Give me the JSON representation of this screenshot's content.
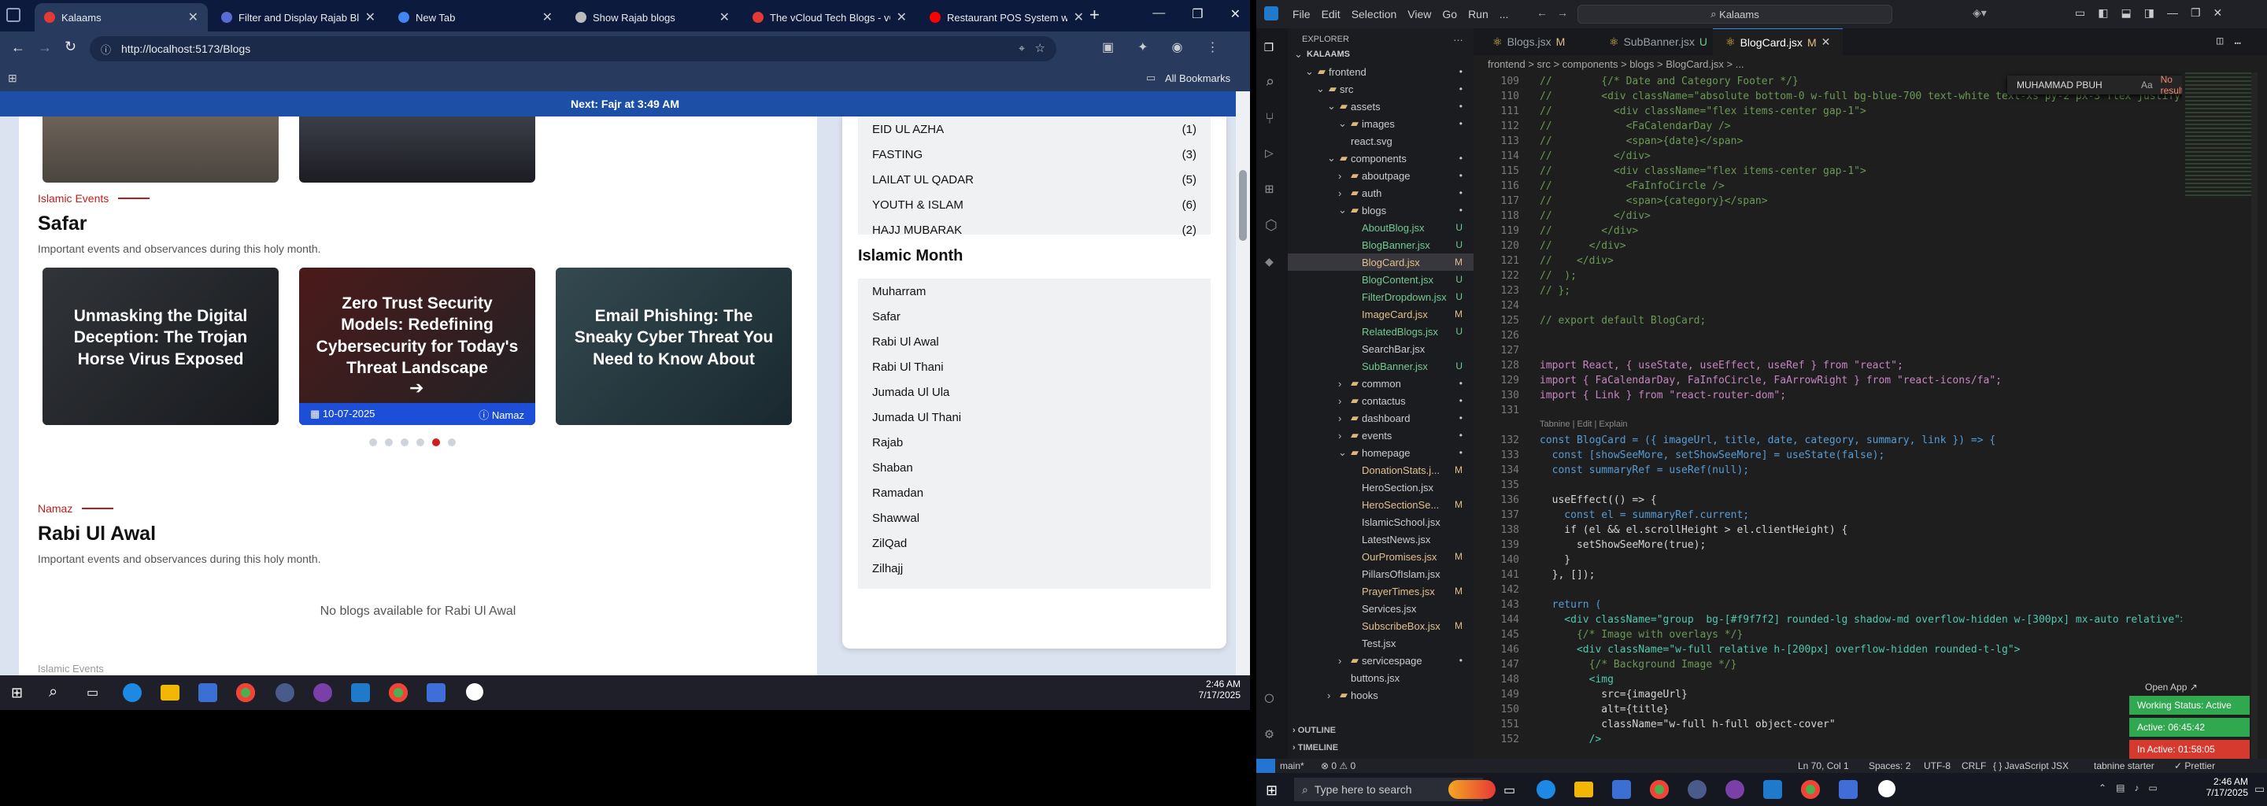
{
  "browser": {
    "tabs": [
      {
        "title": "Kalaams",
        "favicon_color": "#e53935",
        "active": true
      },
      {
        "title": "Filter and Display Rajab Blog",
        "favicon_color": "#5b6bd6",
        "active": false
      },
      {
        "title": "New Tab",
        "favicon_color": "#4285f4",
        "active": false
      },
      {
        "title": "Show Rajab blogs",
        "favicon_color": "#bbbbbb",
        "active": false
      },
      {
        "title": "The vCloud Tech Blogs - vCl",
        "favicon_color": "#e53935",
        "active": false
      },
      {
        "title": "Restaurant POS System with",
        "favicon_color": "#ff0000",
        "active": false
      }
    ],
    "url": "http://localhost:5173/Blogs",
    "bookmarks_label": "All Bookmarks"
  },
  "site": {
    "banner": "Next: Fajr at 3:49 AM",
    "sections": [
      {
        "tag": "Islamic Events",
        "title": "Safar",
        "description": "Important events and observances during this holy month.",
        "cards": [
          {
            "title": "Unmasking the Digital Deception: The Trojan Horse Virus Exposed",
            "color": "#3a3f46"
          },
          {
            "title": "Zero Trust Security Models: Redefining Cybersecurity for Today's Threat Landscape",
            "date": "10-07-2025",
            "category": "Namaz",
            "color": "#7a2b2b"
          },
          {
            "title": "Email Phishing: The Sneaky Cyber Threat You Need to Know About",
            "color": "#4d6e7a"
          }
        ],
        "slide_count": 6,
        "active_slide": 5
      },
      {
        "tag": "Namaz",
        "title": "Rabi Ul Awal",
        "description": "Important events and observances during this holy month.",
        "empty_text": "No blogs available for Rabi Ul Awal"
      }
    ],
    "next_section_stub": "Islamic Events",
    "categories": [
      {
        "name": "EID UL AZHA",
        "count": "(1)"
      },
      {
        "name": "FASTING",
        "count": "(3)"
      },
      {
        "name": "LAILAT UL QADAR",
        "count": "(5)"
      },
      {
        "name": "YOUTH & ISLAM",
        "count": "(6)"
      },
      {
        "name": "HAJJ MUBARAK",
        "count": "(2)"
      }
    ],
    "months_title": "Islamic Month",
    "months": [
      "Muharram",
      "Safar",
      "Rabi Ul Awal",
      "Rabi Ul Thani",
      "Jumada Ul Ula",
      "Jumada Ul Thani",
      "Rajab",
      "Shaban",
      "Ramadan",
      "Shawwal",
      "ZilQad",
      "Zilhajj"
    ]
  },
  "taskbar1": {
    "time": "2:46 AM",
    "date": "7/17/2025"
  },
  "vscode": {
    "menus": [
      "File",
      "Edit",
      "Selection",
      "View",
      "Go",
      "Run",
      "..."
    ],
    "search_text": "Kalaams",
    "explorer_title": "EXPLORER",
    "tree": [
      {
        "name": "KALAAMS",
        "depth": 0,
        "kind": "root"
      },
      {
        "name": "frontend",
        "depth": 1,
        "kind": "folder-open",
        "status": "•"
      },
      {
        "name": "src",
        "depth": 2,
        "kind": "folder-open",
        "status": "•"
      },
      {
        "name": "assets",
        "depth": 3,
        "kind": "folder-open",
        "status": "•"
      },
      {
        "name": "images",
        "depth": 4,
        "kind": "folder-open",
        "status": "•"
      },
      {
        "name": "react.svg",
        "depth": 4,
        "kind": "file"
      },
      {
        "name": "components",
        "depth": 3,
        "kind": "folder-open",
        "status": "•"
      },
      {
        "name": "aboutpage",
        "depth": 4,
        "kind": "folder",
        "status": "•"
      },
      {
        "name": "auth",
        "depth": 4,
        "kind": "folder",
        "status": "•"
      },
      {
        "name": "blogs",
        "depth": 4,
        "kind": "folder-open",
        "status": "•"
      },
      {
        "name": "AboutBlog.jsx",
        "depth": 5,
        "kind": "file",
        "status": "U"
      },
      {
        "name": "BlogBanner.jsx",
        "depth": 5,
        "kind": "file",
        "status": "U"
      },
      {
        "name": "BlogCard.jsx",
        "depth": 5,
        "kind": "file",
        "status": "M",
        "selected": true
      },
      {
        "name": "BlogContent.jsx",
        "depth": 5,
        "kind": "file",
        "status": "U"
      },
      {
        "name": "FilterDropdown.jsx",
        "depth": 5,
        "kind": "file",
        "status": "U"
      },
      {
        "name": "ImageCard.jsx",
        "depth": 5,
        "kind": "file",
        "status": "M"
      },
      {
        "name": "RelatedBlogs.jsx",
        "depth": 5,
        "kind": "file",
        "status": "U"
      },
      {
        "name": "SearchBar.jsx",
        "depth": 5,
        "kind": "file"
      },
      {
        "name": "SubBanner.jsx",
        "depth": 5,
        "kind": "file",
        "status": "U"
      },
      {
        "name": "common",
        "depth": 4,
        "kind": "folder",
        "status": "•"
      },
      {
        "name": "contactus",
        "depth": 4,
        "kind": "folder",
        "status": "•"
      },
      {
        "name": "dashboard",
        "depth": 4,
        "kind": "folder",
        "status": "•"
      },
      {
        "name": "events",
        "depth": 4,
        "kind": "folder",
        "status": "•"
      },
      {
        "name": "homepage",
        "depth": 4,
        "kind": "folder-open",
        "status": "•"
      },
      {
        "name": "DonationStats.j...",
        "depth": 5,
        "kind": "file",
        "status": "M"
      },
      {
        "name": "HeroSection.jsx",
        "depth": 5,
        "kind": "file"
      },
      {
        "name": "HeroSectionSe...",
        "depth": 5,
        "kind": "file",
        "status": "M"
      },
      {
        "name": "IslamicSchool.jsx",
        "depth": 5,
        "kind": "file"
      },
      {
        "name": "LatestNews.jsx",
        "depth": 5,
        "kind": "file"
      },
      {
        "name": "OurPromises.jsx",
        "depth": 5,
        "kind": "file",
        "status": "M"
      },
      {
        "name": "PillarsOfIslam.jsx",
        "depth": 5,
        "kind": "file"
      },
      {
        "name": "PrayerTimes.jsx",
        "depth": 5,
        "kind": "file",
        "status": "M"
      },
      {
        "name": "Services.jsx",
        "depth": 5,
        "kind": "file"
      },
      {
        "name": "SubscribeBox.jsx",
        "depth": 5,
        "kind": "file",
        "status": "M"
      },
      {
        "name": "Test.jsx",
        "depth": 5,
        "kind": "file"
      },
      {
        "name": "servicespage",
        "depth": 4,
        "kind": "folder",
        "status": "•"
      },
      {
        "name": "buttons.jsx",
        "depth": 4,
        "kind": "file"
      },
      {
        "name": "hooks",
        "depth": 3,
        "kind": "folder"
      }
    ],
    "outline": "OUTLINE",
    "timeline": "TIMELINE",
    "editor_tabs": [
      {
        "name": "Blogs.jsx",
        "status": "M"
      },
      {
        "name": "SubBanner.jsx",
        "status": "U"
      },
      {
        "name": "BlogCard.jsx",
        "status": "M",
        "active": true
      }
    ],
    "breadcrumb": "frontend > src > components > blogs > BlogCard.jsx > ...",
    "find_text": "MUHAMMAD PBUH",
    "find_result": "No results",
    "code_lines": [
      {
        "n": "109",
        "t": "//        {/* Date and Category Footer */}"
      },
      {
        "n": "110",
        "t": "//        <div className=\"absolute bottom-0 w-full bg-blue-700 text-white text-xs py-2 px-3 flex justify-"
      },
      {
        "n": "111",
        "t": "//          <div className=\"flex items-center gap-1\">"
      },
      {
        "n": "112",
        "t": "//            <FaCalendarDay />"
      },
      {
        "n": "113",
        "t": "//            <span>{date}</span>"
      },
      {
        "n": "114",
        "t": "//          </div>"
      },
      {
        "n": "115",
        "t": "//          <div className=\"flex items-center gap-1\">"
      },
      {
        "n": "116",
        "t": "//            <FaInfoCircle />"
      },
      {
        "n": "117",
        "t": "//            <span>{category}</span>"
      },
      {
        "n": "118",
        "t": "//          </div>"
      },
      {
        "n": "119",
        "t": "//        </div>"
      },
      {
        "n": "120",
        "t": "//      </div>"
      },
      {
        "n": "121",
        "t": "//    </div>"
      },
      {
        "n": "122",
        "t": "//  );"
      },
      {
        "n": "123",
        "t": "// };"
      },
      {
        "n": "124",
        "t": ""
      },
      {
        "n": "125",
        "t": "// export default BlogCard;"
      },
      {
        "n": "126",
        "t": ""
      },
      {
        "n": "127",
        "t": ""
      },
      {
        "n": "128",
        "t": "import React, { useState, useEffect, useRef } from \"react\";"
      },
      {
        "n": "129",
        "t": "import { FaCalendarDay, FaInfoCircle, FaArrowRight } from \"react-icons/fa\";"
      },
      {
        "n": "130",
        "t": "import { Link } from \"react-router-dom\";"
      },
      {
        "n": "131",
        "t": ""
      },
      {
        "n": "",
        "t": "Tabnine | Edit | Explain"
      },
      {
        "n": "132",
        "t": "const BlogCard = ({ imageUrl, title, date, category, summary, link }) => {"
      },
      {
        "n": "133",
        "t": "  const [showSeeMore, setShowSeeMore] = useState(false);"
      },
      {
        "n": "134",
        "t": "  const summaryRef = useRef(null);"
      },
      {
        "n": "135",
        "t": ""
      },
      {
        "n": "136",
        "t": "  useEffect(() => {"
      },
      {
        "n": "137",
        "t": "    const el = summaryRef.current;"
      },
      {
        "n": "138",
        "t": "    if (el && el.scrollHeight > el.clientHeight) {"
      },
      {
        "n": "139",
        "t": "      setShowSeeMore(true);"
      },
      {
        "n": "140",
        "t": "    }"
      },
      {
        "n": "141",
        "t": "  }, []);"
      },
      {
        "n": "142",
        "t": ""
      },
      {
        "n": "143",
        "t": "  return ("
      },
      {
        "n": "144",
        "t": "    <div className=\"group  bg-[#f9f7f2] rounded-lg shadow-md overflow-hidden w-[300px] mx-auto relative\">"
      },
      {
        "n": "145",
        "t": "      {/* Image with overlays */}"
      },
      {
        "n": "146",
        "t": "      <div className=\"w-full relative h-[200px] overflow-hidden rounded-t-lg\">"
      },
      {
        "n": "147",
        "t": "        {/* Background Image */}"
      },
      {
        "n": "148",
        "t": "        <img"
      },
      {
        "n": "149",
        "t": "          src={imageUrl}"
      },
      {
        "n": "150",
        "t": "          alt={title}"
      },
      {
        "n": "151",
        "t": "          className=\"w-full h-full object-cover\""
      },
      {
        "n": "152",
        "t": "        />"
      }
    ],
    "status": {
      "branch": "main*",
      "errors": "⊗ 0 ⚠ 0",
      "position": "Ln 70, Col 1",
      "spaces": "Spaces: 2",
      "encoding": "UTF-8",
      "eol": "CRLF",
      "language": "{ } JavaScript JSX",
      "tabnine": "tabnine starter",
      "prettier": "✓ Prettier"
    },
    "open_app": "Open App ↗",
    "badges": [
      {
        "text": "Working Status: Active",
        "color": "#2fa84f"
      },
      {
        "text": "Active: 06:45:42",
        "color": "#2fa84f"
      },
      {
        "text": "In Active: 01:58:05",
        "color": "#d63a2f"
      }
    ]
  },
  "taskbar2": {
    "search_placeholder": "Type here to search",
    "time": "2:46 AM",
    "date": "7/17/2025"
  }
}
